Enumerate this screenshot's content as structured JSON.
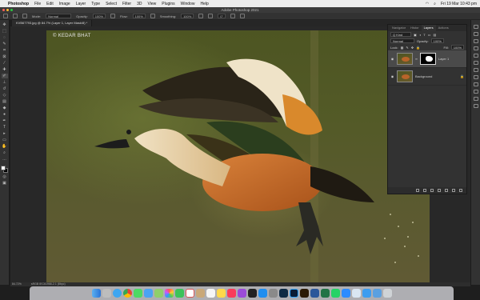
{
  "menubar": {
    "app_name": "Photoshop",
    "items": [
      "File",
      "Edit",
      "Image",
      "Layer",
      "Type",
      "Select",
      "Filter",
      "3D",
      "View",
      "Plugins",
      "Window",
      "Help"
    ],
    "clock": "Fri 19 Mar  10:43 pm"
  },
  "window": {
    "title": "Adobe Photoshop 2021"
  },
  "options": {
    "mode_label": "Mode:",
    "mode_value": "Normal",
    "opacity_label": "Opacity:",
    "opacity_value": "100%",
    "flow_label": "Flow:",
    "flow_value": "100%",
    "smoothing_label": "Smoothing:",
    "smoothing_value": "100%",
    "angle_value": "0°"
  },
  "document": {
    "tab_label": "KVB67793.jpg @ 84.7% (Layer 1, Layer Mask/8) *",
    "watermark": "© KEDAR BHAT",
    "status_zoom": "84.72%",
    "status_profile": "sRGB IEC61966-2.1 (8bpc)"
  },
  "panel": {
    "tabs": [
      "Navigator",
      "Histor",
      "Layers",
      "Actions"
    ],
    "active_tab": "Layers",
    "kind_label": "Q Kind",
    "blend_mode": "Normal",
    "opacity_label": "Opacity:",
    "opacity_value": "100%",
    "lock_label": "Lock:",
    "fill_label": "Fill:",
    "fill_value": "100%",
    "layers": [
      {
        "name": "Layer 1",
        "selected": true,
        "has_mask": true
      },
      {
        "name": "Background",
        "selected": false,
        "locked": true
      }
    ]
  },
  "colors": {
    "menubar": "#ececec",
    "ps_dark": "#323232",
    "photo_bg": "#535a27",
    "duck_orange": "#c8651f"
  },
  "icons": {
    "apple": "apple-icon",
    "layer_visible": "eye-icon",
    "layer_lock": "lock-icon"
  }
}
